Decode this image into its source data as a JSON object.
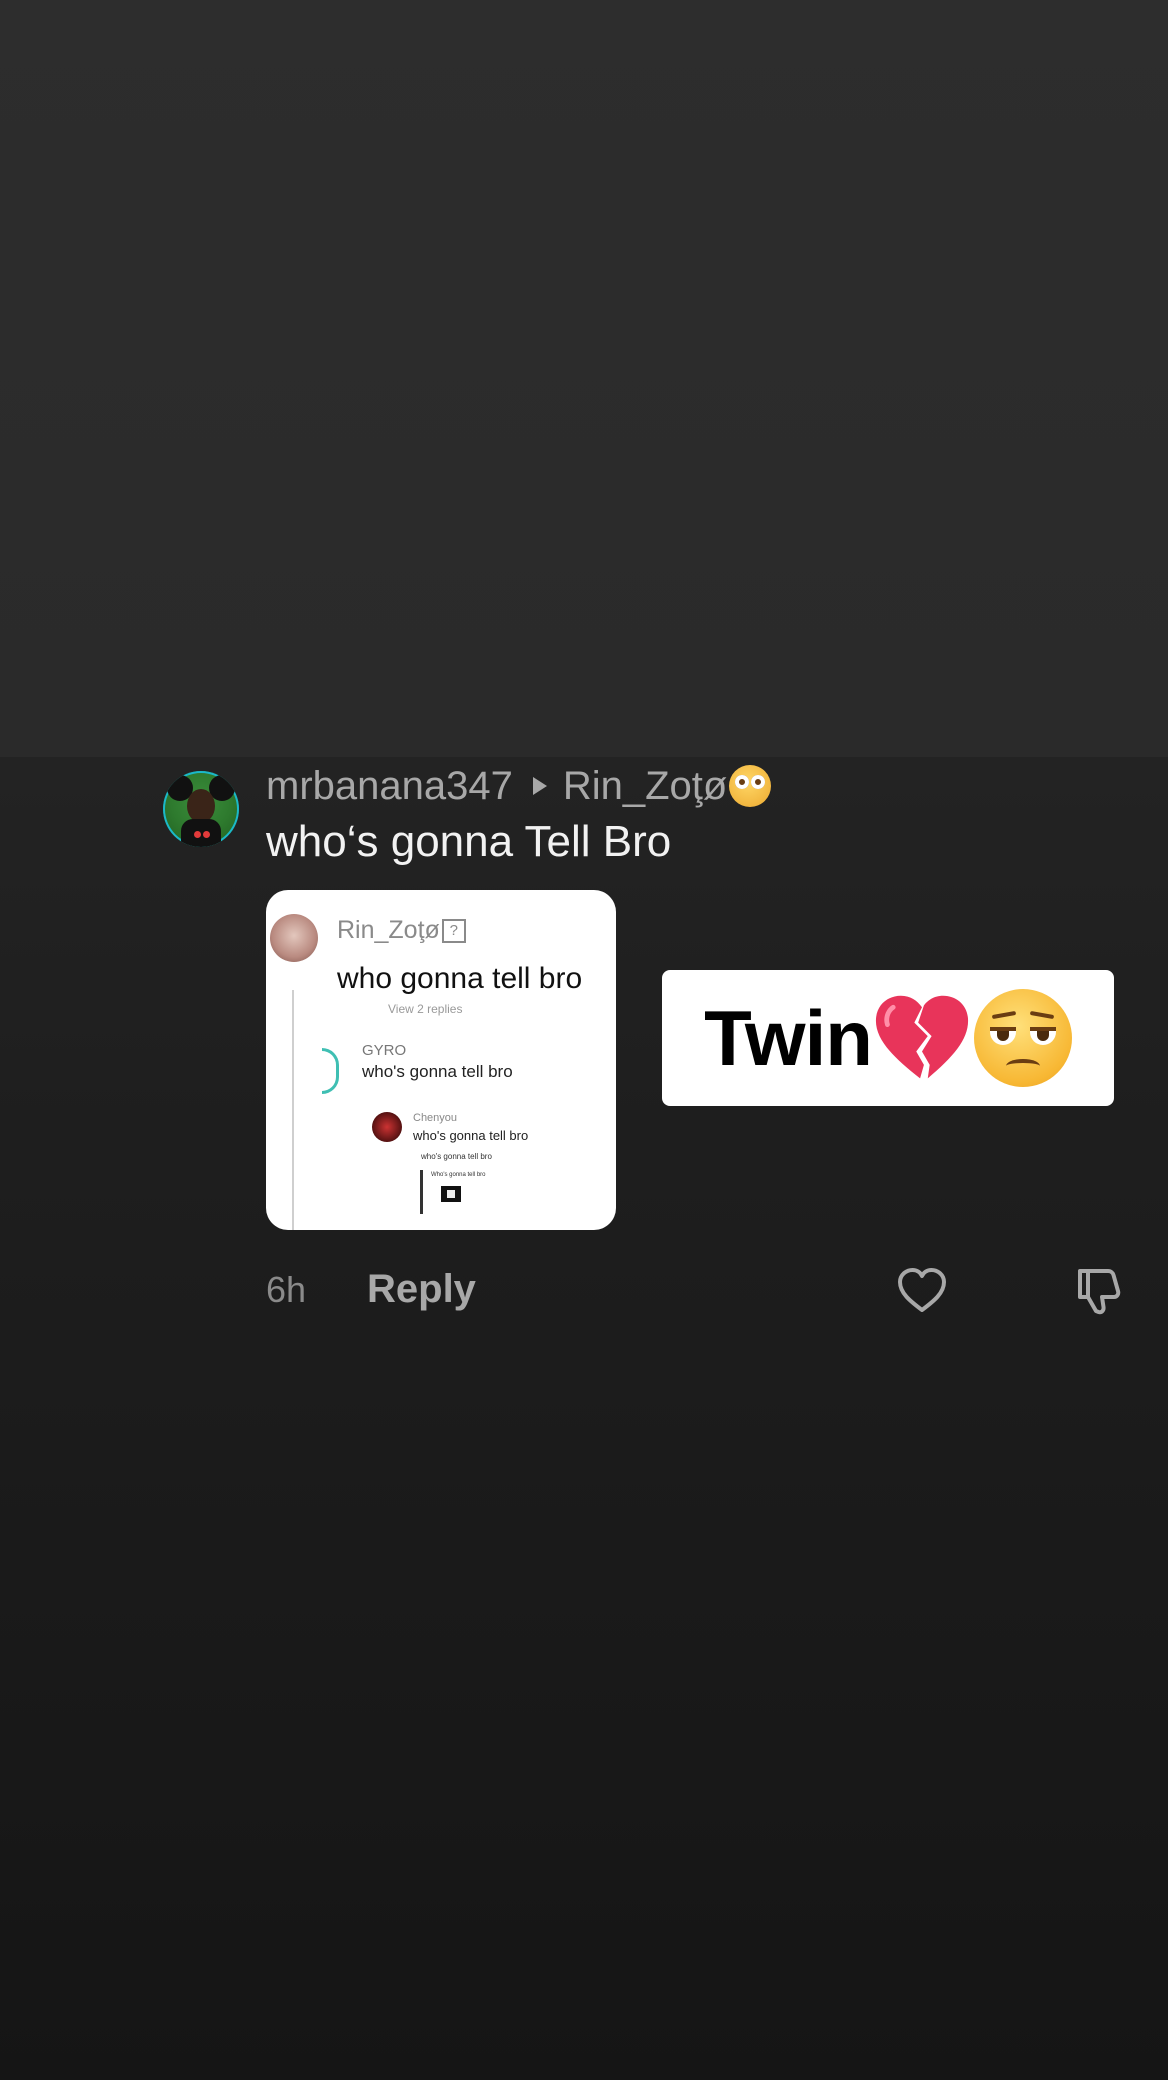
{
  "comment": {
    "username": "mrbanana347",
    "reply_to": "Rin_Zoţø",
    "reply_to_emoji": "flushed-face-icon",
    "text": "who‘s gonna Tell Bro",
    "time": "6h",
    "reply_label": "Reply"
  },
  "attachment": {
    "screenshot": {
      "user": "Rin_Zoţø",
      "user_badge": "?",
      "comment": "who gonna tell bro",
      "view_replies": "View 2 replies",
      "nested_user": "GYRO",
      "nested_comment": "who's gonna tell bro",
      "nested2_user": "Chenyou",
      "nested2_comment": "who's gonna tell bro",
      "nested3_comment": "who's gonna tell bro",
      "nested4_comment": "Who's gonna tell bro"
    },
    "sticker": {
      "text": "Twin",
      "emoji1": "broken-heart-icon",
      "emoji2": "unamused-face-icon"
    }
  },
  "colors": {
    "background_top": "#2a2a2a",
    "background_bottom": "#151515",
    "username": "#a8a8a8",
    "comment_text": "#f2f2f2",
    "muted": "#8a8a8a",
    "heart_red": "#e8345a"
  }
}
